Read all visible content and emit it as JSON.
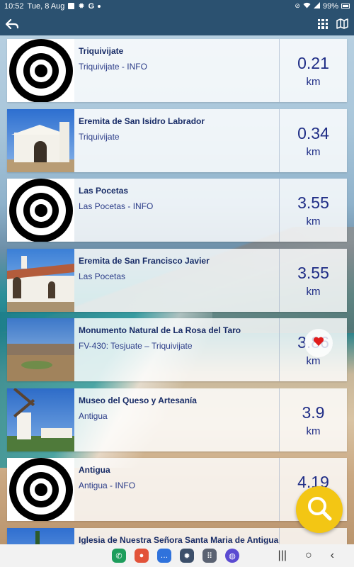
{
  "status_bar": {
    "time": "10:52",
    "date": "Tue, 8 Aug",
    "notification_icons": [
      "gallery-icon",
      "gear-icon",
      "google-icon",
      "dot-icon"
    ],
    "system_icons": [
      "mute-icon",
      "wifi-icon",
      "signal-icon"
    ],
    "battery": "99%"
  },
  "app_bar": {
    "back_icon": "back-arrow-icon",
    "actions": [
      "grid-view-icon",
      "map-view-icon"
    ],
    "background_color": "#2b5170"
  },
  "places": [
    {
      "title": "Triquivijate",
      "subtitle": "Triquivijate - INFO",
      "distance": "0.21",
      "unit": "km",
      "thumbnail": "target-icon"
    },
    {
      "title": "Eremita de San Isidro Labrador",
      "subtitle": "Triquivijate",
      "distance": "0.34",
      "unit": "km",
      "thumbnail": "chapel-photo"
    },
    {
      "title": "Las Pocetas",
      "subtitle": "Las Pocetas - INFO",
      "distance": "3.55",
      "unit": "km",
      "thumbnail": "target-icon"
    },
    {
      "title": "Eremita de San Francisco Javier",
      "subtitle": "Las Pocetas",
      "distance": "3.55",
      "unit": "km",
      "thumbnail": "hermitage-photo"
    },
    {
      "title": "Monumento Natural de La Rosa del Taro",
      "subtitle": "FV-430: Tesjuate – Triquivijate",
      "distance": "3.86",
      "unit": "km",
      "thumbnail": "landscape-photo"
    },
    {
      "title": "Museo del Queso y Artesanía",
      "subtitle": "Antigua",
      "distance": "3.9",
      "unit": "km",
      "thumbnail": "windmill-photo"
    },
    {
      "title": "Antigua",
      "subtitle": "Antigua - INFO",
      "distance": "4.19",
      "unit": "km",
      "thumbnail": "target-icon"
    },
    {
      "title": "Iglesia de Nuestra Señora Santa Maria de Antigua",
      "subtitle": "",
      "distance": "",
      "unit": "",
      "thumbnail": "church-photo"
    }
  ],
  "floating": {
    "favorite_icon": "heart-icon",
    "search_icon": "search-icon",
    "search_color": "#f3c614"
  },
  "nav_bar": {
    "apps": [
      "phone-app-icon",
      "contacts-app-icon",
      "messages-app-icon",
      "settings-app-icon",
      "app-drawer-icon",
      "internet-app-icon"
    ],
    "system_buttons": [
      "recents-icon",
      "home-icon",
      "back-icon"
    ]
  }
}
